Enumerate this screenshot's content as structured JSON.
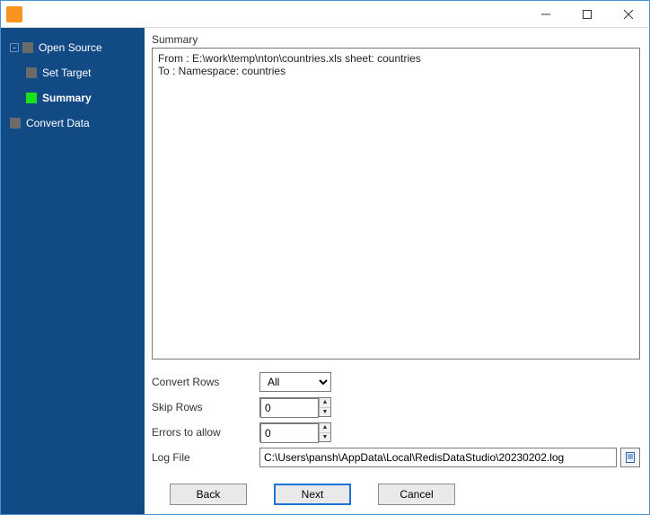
{
  "titlebar": {
    "app_name": ""
  },
  "sidebar": {
    "items": [
      {
        "label": "Open Source",
        "toggle": "-"
      },
      {
        "label": "Set Target"
      },
      {
        "label": "Summary"
      },
      {
        "label": "Convert Data"
      }
    ],
    "active_index": 2
  },
  "main": {
    "section_title": "Summary",
    "summary_text": "From : E:\\work\\temp\\nton\\countries.xls sheet: countries\nTo : Namespace: countries",
    "form": {
      "convert_rows_label": "Convert Rows",
      "convert_rows_value": "All",
      "skip_rows_label": "Skip Rows",
      "skip_rows_value": "0",
      "errors_label": "Errors to allow",
      "errors_value": "0",
      "logfile_label": "Log File",
      "logfile_value": "C:\\Users\\pansh\\AppData\\Local\\RedisDataStudio\\20230202.log"
    },
    "buttons": {
      "back": "Back",
      "next": "Next",
      "cancel": "Cancel"
    }
  }
}
